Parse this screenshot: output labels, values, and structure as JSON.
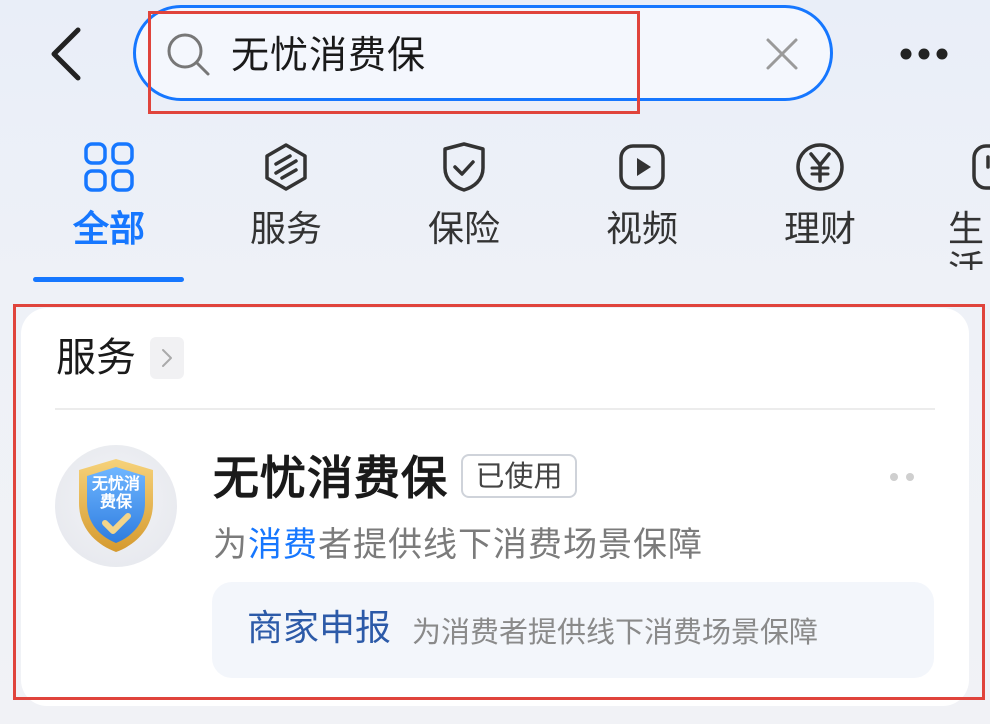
{
  "search": {
    "value": "无忧消费保"
  },
  "tabs": [
    {
      "label": "全部",
      "icon": "grid-icon",
      "active": true
    },
    {
      "label": "服务",
      "icon": "service-icon"
    },
    {
      "label": "保险",
      "icon": "shield-check-icon"
    },
    {
      "label": "视频",
      "icon": "play-icon"
    },
    {
      "label": "理财",
      "icon": "yen-icon"
    },
    {
      "label": "生活",
      "icon": "life-icon"
    }
  ],
  "section": {
    "title": "服务"
  },
  "result": {
    "logo_text": "无忧消费保",
    "name": "无忧消费保",
    "badge": "已使用",
    "desc_pre": "为",
    "desc_highlight": "消费",
    "desc_post": "者提供线下消费场景保障",
    "sub_label": "商家申报",
    "sub_desc": "为消费者提供线下消费场景保障"
  },
  "colors": {
    "accent": "#1677ff",
    "annotation": "#e0443c"
  }
}
